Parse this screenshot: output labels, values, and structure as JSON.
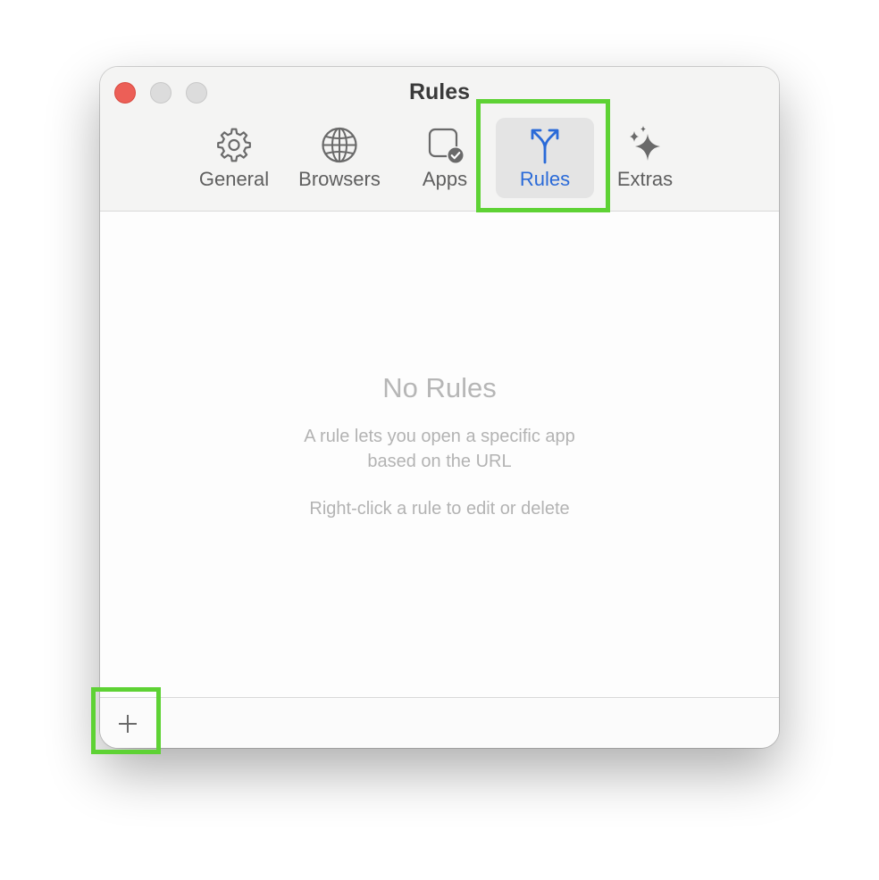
{
  "window": {
    "title": "Rules"
  },
  "toolbar": {
    "tabs": [
      {
        "label": "General",
        "icon": "gear-icon",
        "selected": false
      },
      {
        "label": "Browsers",
        "icon": "globe-icon",
        "selected": false
      },
      {
        "label": "Apps",
        "icon": "app-check-icon",
        "selected": false
      },
      {
        "label": "Rules",
        "icon": "fork-arrows-icon",
        "selected": true
      },
      {
        "label": "Extras",
        "icon": "sparkles-icon",
        "selected": false
      }
    ]
  },
  "empty_state": {
    "title": "No Rules",
    "description_line1": "A rule lets you open a specific app",
    "description_line2": "based on the URL",
    "hint": "Right-click a rule to edit or delete"
  },
  "bottom_bar": {
    "add_icon": "plus-icon"
  },
  "colors": {
    "accent": "#2a6ad8",
    "highlight": "#5ed234",
    "close": "#ec5f57"
  }
}
